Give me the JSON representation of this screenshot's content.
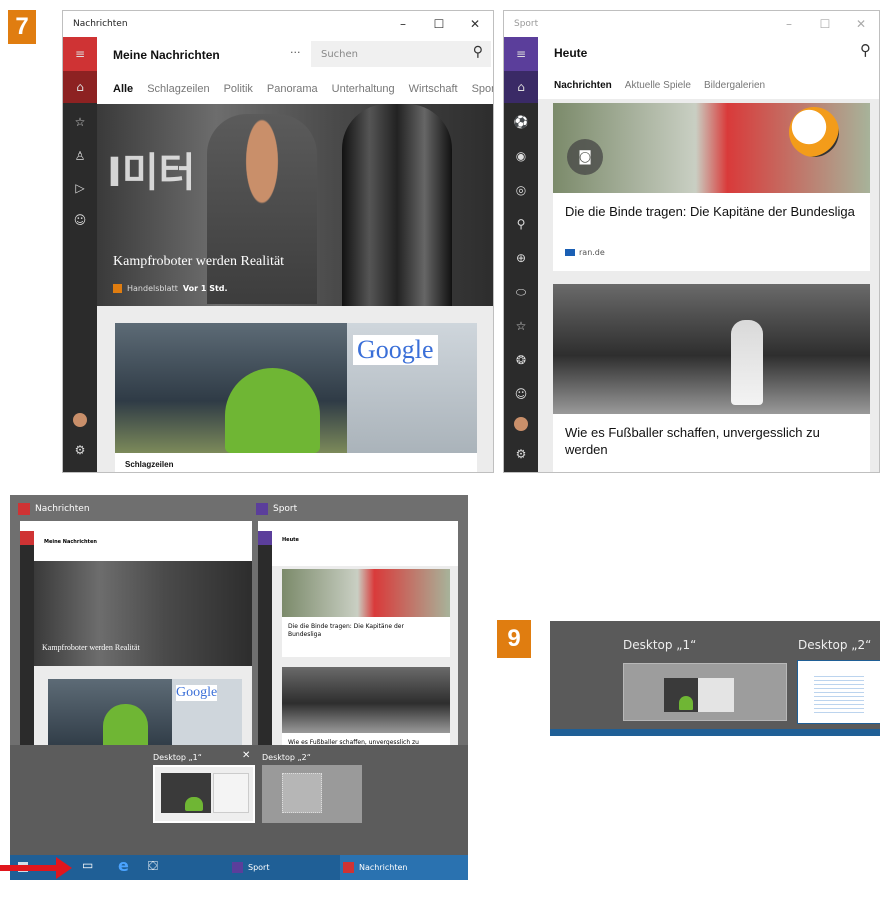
{
  "step_labels": {
    "seven": "7",
    "nine": "9"
  },
  "colors": {
    "accent_orange": "#e07d10",
    "news_red": "#cf3334",
    "sport_purple": "#5b3e9b",
    "taskbar_blue": "#1f5f96"
  },
  "news_window": {
    "title": "Nachrichten",
    "minimize": "–",
    "maximize": "☐",
    "close": "✕",
    "header": "Meine Nachrichten",
    "more": "···",
    "search_placeholder": "Suchen",
    "tabs": [
      "Alle",
      "Schlagzeilen",
      "Politik",
      "Panorama",
      "Unterhaltung",
      "Wirtschaft",
      "Sport"
    ],
    "hero_headline": "Kampfroboter werden Realität",
    "hero_source": "Handelsblatt",
    "hero_time": "Vor 1 Std.",
    "hero_sign_text": "I미터",
    "google_sign": "Google",
    "section_label": "Schlagzeilen"
  },
  "sport_window": {
    "title": "Sport",
    "minimize": "–",
    "maximize": "☐",
    "close": "✕",
    "header": "Heute",
    "tabs": [
      "Nachrichten",
      "Aktuelle Spiele",
      "Bildergalerien"
    ],
    "article1_title": "Die die Binde tragen: Die Kapitäne der Bundesliga",
    "article1_source": "ran.de",
    "article2_title": "Wie es Fußballer schaffen, unvergesslich zu werden"
  },
  "task_view": {
    "news_label": "Nachrichten",
    "sport_label": "Sport",
    "desktop1": "Desktop „1“",
    "desktop2": "Desktop „2“",
    "close": "✕",
    "taskbar_sport": "Sport",
    "taskbar_news": "Nachrichten"
  },
  "virtual_desktops": {
    "desktop1": "Desktop „1“",
    "desktop2": "Desktop „2“"
  }
}
